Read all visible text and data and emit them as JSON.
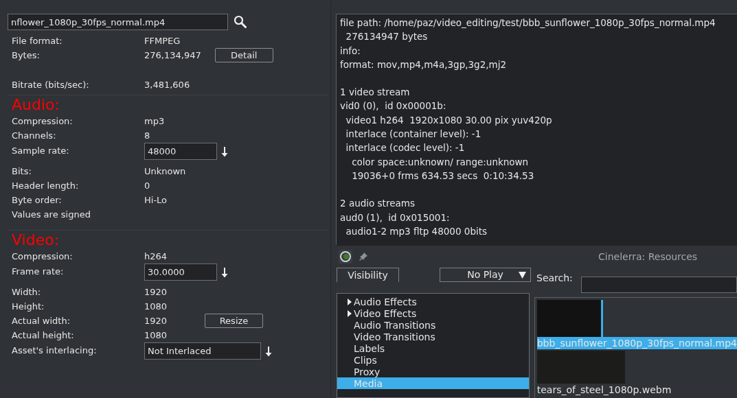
{
  "asset_info": {
    "path_field": {
      "value": "nflower_1080p_30fps_normal.mp4"
    },
    "general": [
      {
        "kind": "text",
        "label": "File format:",
        "value": "FFMPEG"
      },
      {
        "kind": "text",
        "label": "Bytes:",
        "value": "276,134,947",
        "button": "Detail"
      },
      {
        "kind": "spacer"
      },
      {
        "kind": "text",
        "label": "Bitrate (bits/sec):",
        "value": "3,481,606"
      }
    ],
    "audio": {
      "heading": "Audio:",
      "rows": [
        {
          "kind": "text",
          "label": "Compression:",
          "value": "mp3"
        },
        {
          "kind": "text",
          "label": "Channels:",
          "value": "8"
        },
        {
          "kind": "input",
          "label": "Sample rate:",
          "value": "48000"
        },
        {
          "kind": "text",
          "label": "Bits:",
          "value": "Unknown"
        },
        {
          "kind": "text",
          "label": "Header length:",
          "value": "0"
        },
        {
          "kind": "text",
          "label": "Byte order:",
          "value": "Hi-Lo"
        },
        {
          "kind": "text",
          "label": "Values are signed"
        }
      ]
    },
    "video": {
      "heading": "Video:",
      "rows": [
        {
          "kind": "text",
          "label": "Compression:",
          "value": "h264"
        },
        {
          "kind": "input",
          "label": "Frame rate:",
          "value": "30.0000"
        },
        {
          "kind": "text",
          "label": "Width:",
          "value": "1920"
        },
        {
          "kind": "text",
          "label": "Height:",
          "value": "1080"
        },
        {
          "kind": "text",
          "label": "Actual width:",
          "value": "1920",
          "button": "Resize"
        },
        {
          "kind": "text",
          "label": "Actual height:",
          "value": "1080"
        },
        {
          "kind": "wideinput",
          "label": "Asset's interlacing:",
          "value": "Not Interlaced"
        }
      ]
    }
  },
  "detail": {
    "paragraphs": [
      [
        "file path: /home/paz/video_editing/test/bbb_sunflower_1080p_30fps_normal.mp4",
        "  276134947 bytes",
        "info:",
        "format: mov,mp4,m4a,3gp,3g2,mj2"
      ],
      [
        "1 video stream",
        "vid0 (0),  id 0x00001b:",
        "  video1 h264  1920x1080 30.00 pix yuv420p",
        "  interlace (container level): -1",
        "  interlace (codec level): -1",
        "    color space:unknown/ range:unknown",
        "    19036+0 frms 634.53 secs  0:10:34.53"
      ],
      [
        "2 audio streams",
        "aud0 (1),  id 0x015001:",
        "  audio1-2 mp3 fltp 48000 0bits"
      ]
    ]
  },
  "resources": {
    "title": "Cinelerra: Resources",
    "visibility_button": "Visibility",
    "play_dropdown": "No Play",
    "search": {
      "label": "Search:"
    },
    "folders": [
      {
        "label": "Audio Effects",
        "expanded": false,
        "selected": false
      },
      {
        "label": "Video Effects",
        "expanded": false,
        "selected": false
      },
      {
        "label": "Audio Transitions",
        "selected": false
      },
      {
        "label": "Video Transitions",
        "selected": false
      },
      {
        "label": "Labels",
        "selected": false
      },
      {
        "label": "Clips",
        "selected": false
      },
      {
        "label": "Proxy",
        "selected": false
      },
      {
        "label": "Media",
        "selected": true
      }
    ],
    "assets": [
      {
        "name": "bbb_sunflower_1080p_30fps_normal.mp4",
        "selected": true
      },
      {
        "name": "tears_of_steel_1080p.webm",
        "selected": false
      }
    ]
  }
}
